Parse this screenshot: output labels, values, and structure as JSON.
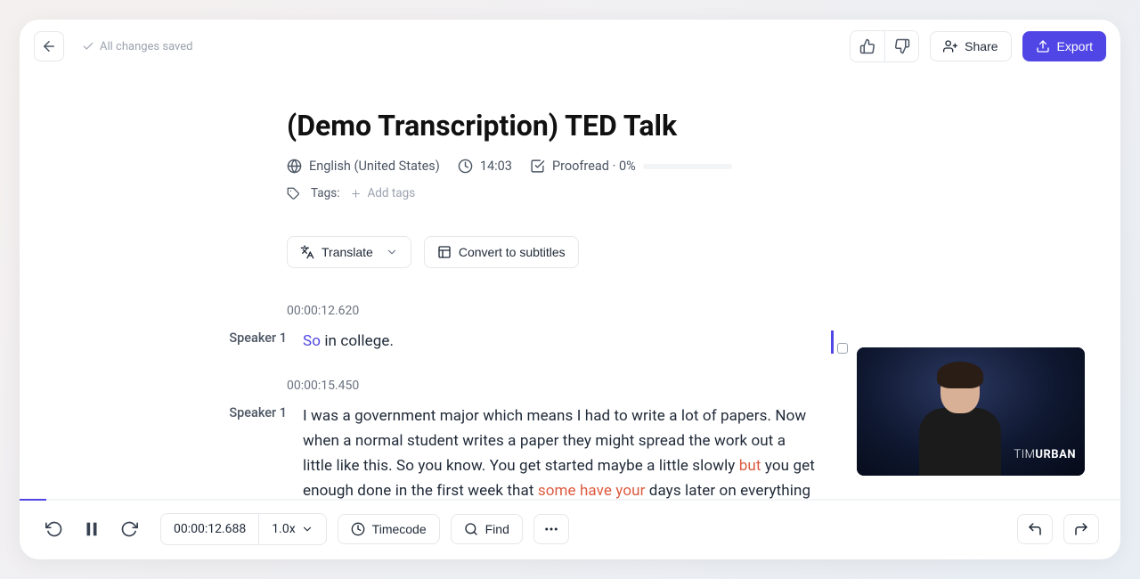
{
  "header": {
    "saved_label": "All changes saved",
    "share_label": "Share",
    "export_label": "Export"
  },
  "document": {
    "title": "(Demo Transcription) TED Talk",
    "language": "English (United States)",
    "duration": "14:03",
    "proofread_label": "Proofread · 0%",
    "proofread_percent": 0,
    "tags_label": "Tags:",
    "add_tags_label": "Add tags"
  },
  "actions": {
    "translate_label": "Translate",
    "convert_label": "Convert to subtitles"
  },
  "segments": [
    {
      "time": "00:00:12.620",
      "speaker": "Speaker 1",
      "text_parts": [
        {
          "text": "So",
          "style": "blue"
        },
        {
          "text": " in college.",
          "style": "normal"
        }
      ],
      "has_cursor": true
    },
    {
      "time": "00:00:15.450",
      "speaker": "Speaker 1",
      "text_parts": [
        {
          "text": "I was a government major which means I had to write a lot of papers. Now when a normal student writes a paper they might spread the work out a little like this. So you know. You get started maybe a little slowly ",
          "style": "normal"
        },
        {
          "text": "but",
          "style": "red"
        },
        {
          "text": " you get enough done in the first week that ",
          "style": "normal"
        },
        {
          "text": "some have your",
          "style": "red"
        },
        {
          "text": " days later on everything",
          "style": "normal"
        }
      ],
      "has_cursor": false
    }
  ],
  "video": {
    "name_first": "TIM",
    "name_last": "URBAN"
  },
  "playbar": {
    "current_time": "00:00:12.688",
    "speed": "1.0x",
    "timecode_label": "Timecode",
    "find_label": "Find",
    "progress_percent": 2.4
  }
}
